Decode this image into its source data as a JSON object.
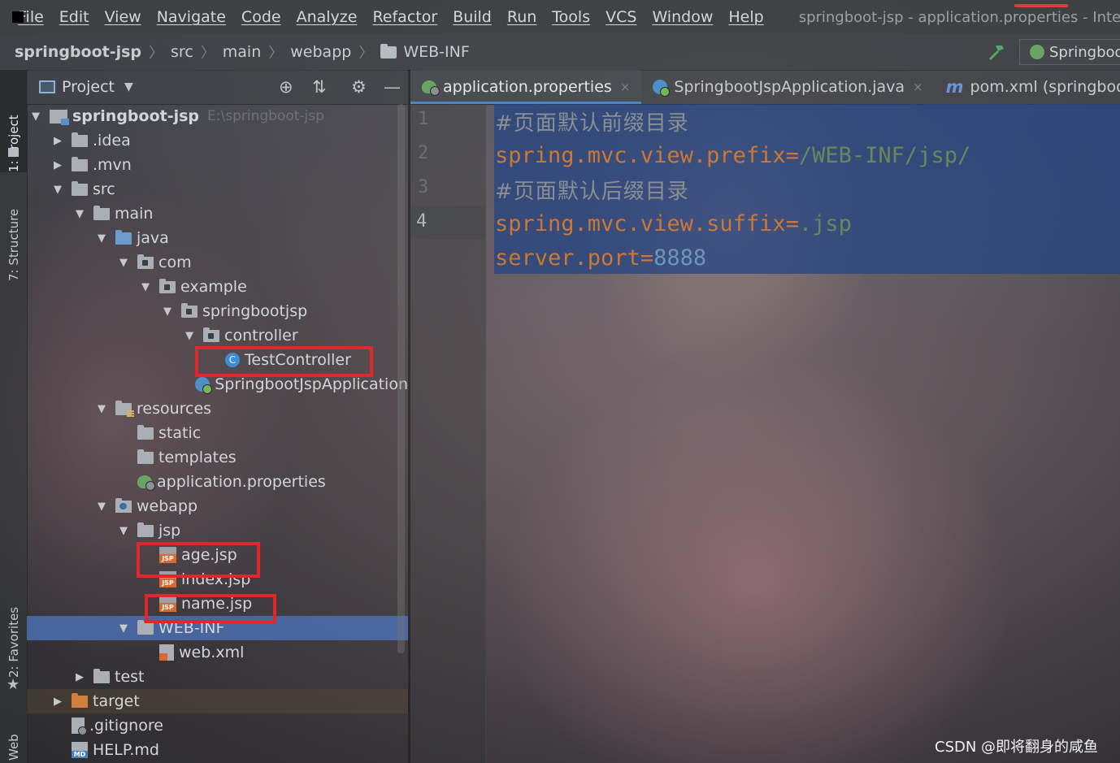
{
  "menubar": {
    "items": [
      "File",
      "Edit",
      "View",
      "Navigate",
      "Code",
      "Analyze",
      "Refactor",
      "Build",
      "Run",
      "Tools",
      "VCS",
      "Window",
      "Help"
    ],
    "window_title": "springboot-jsp - application.properties - IntelliJ I"
  },
  "navbar": {
    "crumbs": [
      "springboot-jsp",
      "src",
      "main",
      "webapp",
      "WEB-INF"
    ],
    "run_config": "Springboo"
  },
  "toolstrip": {
    "project_tab": "1: Project",
    "structure_tab": "7: Structure",
    "favorites_tab": "2: Favorites",
    "web_tab": "Web"
  },
  "project_panel": {
    "title": "Project",
    "tree": [
      {
        "label": "springboot-jsp",
        "path": "E:\\springboot-jsp",
        "arrow": "down",
        "icon": "module-icon",
        "bold": true
      },
      {
        "label": ".idea",
        "arrow": "right",
        "icon": "folder-icon"
      },
      {
        "label": ".mvn",
        "arrow": "right",
        "icon": "folder-icon"
      },
      {
        "label": "src",
        "arrow": "down",
        "icon": "folder-icon"
      },
      {
        "label": "main",
        "arrow": "down",
        "icon": "folder-icon"
      },
      {
        "label": "java",
        "arrow": "down",
        "icon": "source-folder-icon"
      },
      {
        "label": "com",
        "arrow": "down",
        "icon": "package-icon"
      },
      {
        "label": "example",
        "arrow": "down",
        "icon": "package-icon"
      },
      {
        "label": "springbootjsp",
        "arrow": "down",
        "icon": "package-icon"
      },
      {
        "label": "controller",
        "arrow": "down",
        "icon": "package-icon"
      },
      {
        "label": "TestController",
        "arrow": "",
        "icon": "class-icon"
      },
      {
        "label": "SpringbootJspApplication",
        "arrow": "",
        "icon": "spring-boot-class-icon"
      },
      {
        "label": "resources",
        "arrow": "down",
        "icon": "resources-folder-icon"
      },
      {
        "label": "static",
        "arrow": "",
        "icon": "folder-icon"
      },
      {
        "label": "templates",
        "arrow": "",
        "icon": "folder-icon"
      },
      {
        "label": "application.properties",
        "arrow": "",
        "icon": "properties-file-icon"
      },
      {
        "label": "webapp",
        "arrow": "down",
        "icon": "web-folder-icon"
      },
      {
        "label": "jsp",
        "arrow": "down",
        "icon": "folder-icon"
      },
      {
        "label": "age.jsp",
        "arrow": "",
        "icon": "jsp-file-icon"
      },
      {
        "label": "index.jsp",
        "arrow": "",
        "icon": "jsp-file-icon"
      },
      {
        "label": "name.jsp",
        "arrow": "",
        "icon": "jsp-file-icon"
      },
      {
        "label": "WEB-INF",
        "arrow": "down",
        "icon": "folder-icon"
      },
      {
        "label": "web.xml",
        "arrow": "",
        "icon": "xml-file-icon"
      },
      {
        "label": "test",
        "arrow": "right",
        "icon": "folder-icon"
      },
      {
        "label": "target",
        "arrow": "right",
        "icon": "excluded-folder-icon"
      },
      {
        "label": ".gitignore",
        "arrow": "",
        "icon": "gitignore-file-icon"
      },
      {
        "label": "HELP.md",
        "arrow": "",
        "icon": "markdown-file-icon"
      }
    ]
  },
  "editor": {
    "tabs": [
      {
        "label": "application.properties",
        "active": true,
        "icon": "properties-file-icon"
      },
      {
        "label": "SpringbootJspApplication.java",
        "active": false,
        "icon": "spring-boot-class-icon"
      },
      {
        "label": "pom.xml (springboot-jsp)",
        "active": false,
        "icon": "maven-icon"
      }
    ],
    "lines": [
      {
        "number": "1",
        "comment": "#页面默认前缀目录"
      },
      {
        "number": "2",
        "key": "spring.mvc.view.prefix",
        "eq": "=",
        "value": "/WEB-INF/jsp/"
      },
      {
        "number": "3",
        "comment": "#页面默认后缀目录"
      },
      {
        "number": "4",
        "key": "spring.mvc.view.suffix",
        "eq": "=",
        "value": ".jsp"
      },
      {
        "number": "",
        "key": "server.port",
        "eq": "=",
        "value": "8888"
      }
    ]
  },
  "watermark": "CSDN @即将翻身的咸鱼",
  "colors": {
    "keyword": "#cc7832",
    "string": "#6a8759",
    "number": "#6897bb",
    "selection": "#214283",
    "annotation_box": "#e0272b"
  }
}
